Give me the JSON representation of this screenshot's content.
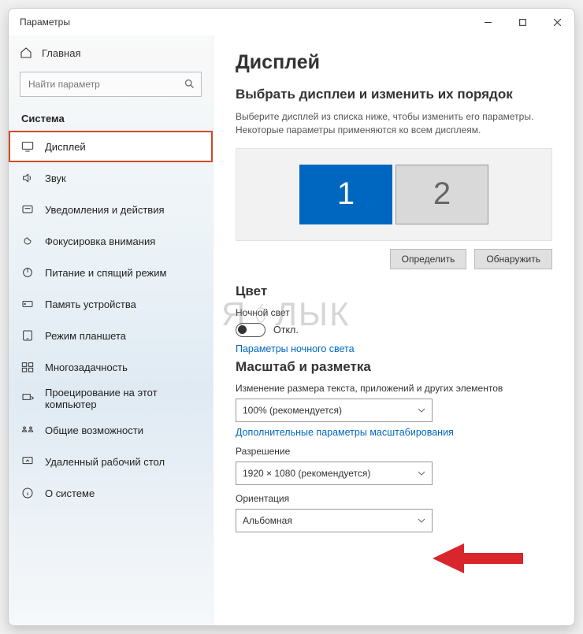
{
  "window": {
    "title": "Параметры"
  },
  "sidebar": {
    "home": "Главная",
    "search_placeholder": "Найти параметр",
    "category": "Система",
    "items": [
      {
        "label": "Дисплей"
      },
      {
        "label": "Звук"
      },
      {
        "label": "Уведомления и действия"
      },
      {
        "label": "Фокусировка внимания"
      },
      {
        "label": "Питание и спящий режим"
      },
      {
        "label": "Память устройства"
      },
      {
        "label": "Режим планшета"
      },
      {
        "label": "Многозадачность"
      },
      {
        "label": "Проецирование на этот компьютер"
      },
      {
        "label": "Общие возможности"
      },
      {
        "label": "Удаленный рабочий стол"
      },
      {
        "label": "О системе"
      }
    ]
  },
  "main": {
    "title": "Дисплей",
    "arrange_title": "Выбрать дисплеи и изменить их порядок",
    "arrange_desc": "Выберите дисплей из списка ниже, чтобы изменить его параметры. Некоторые параметры применяются ко всем дисплеям.",
    "monitors": {
      "m1": "1",
      "m2": "2"
    },
    "btn_identify": "Определить",
    "btn_detect": "Обнаружить",
    "color_title": "Цвет",
    "nightlight_label": "Ночной свет",
    "nightlight_state": "Откл.",
    "nightlight_link": "Параметры ночного света",
    "scale_title": "Масштаб и разметка",
    "scale_label": "Изменение размера текста, приложений и других элементов",
    "scale_value": "100% (рекомендуется)",
    "scale_link": "Дополнительные параметры масштабирования",
    "resolution_label": "Разрешение",
    "resolution_value": "1920 × 1080 (рекомендуется)",
    "orientation_label": "Ориентация",
    "orientation_value": "Альбомная"
  },
  "watermark": "ЯБЛЫК"
}
